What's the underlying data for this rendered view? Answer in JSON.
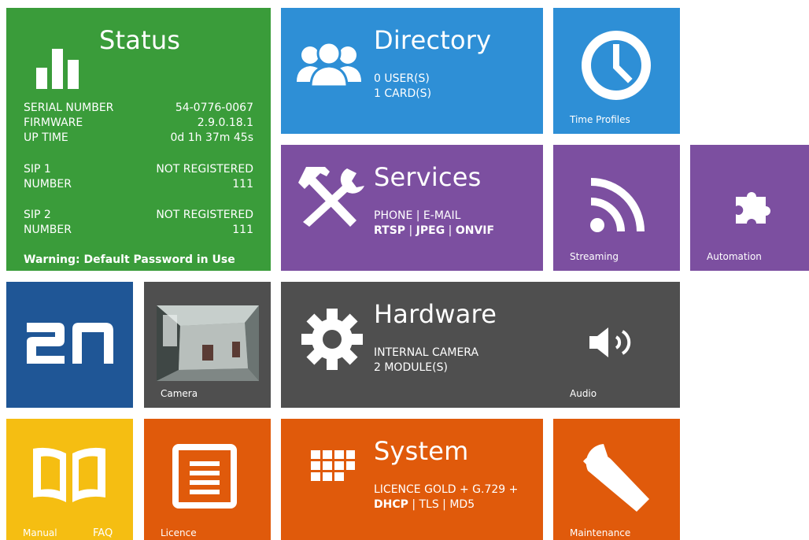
{
  "status": {
    "title": "Status",
    "rows": [
      {
        "label": "SERIAL NUMBER",
        "value": "54-0776-0067"
      },
      {
        "label": "FIRMWARE",
        "value": "2.9.0.18.1"
      },
      {
        "label": "UP TIME",
        "value": "0d 1h 37m 45s"
      }
    ],
    "sip1": [
      {
        "label": "SIP 1",
        "value": "NOT REGISTERED"
      },
      {
        "label": "NUMBER",
        "value": "111"
      }
    ],
    "sip2": [
      {
        "label": "SIP 2",
        "value": "NOT REGISTERED"
      },
      {
        "label": "NUMBER",
        "value": "111"
      }
    ],
    "warning": "Warning: Default Password in Use"
  },
  "directory": {
    "title": "Directory",
    "line1": "0 USER(S)",
    "line2": "1 CARD(S)"
  },
  "time_profiles": {
    "label": "Time Profiles"
  },
  "services": {
    "title": "Services",
    "line1": "PHONE | E-MAIL",
    "line2_a": "RTSP",
    "line2_sep1": " | ",
    "line2_b": "JPEG",
    "line2_sep2": " | ",
    "line2_c": "ONVIF"
  },
  "streaming": {
    "label": "Streaming"
  },
  "automation": {
    "label": "Automation"
  },
  "logo": {
    "text": "2N"
  },
  "camera": {
    "label": "Camera"
  },
  "hardware": {
    "title": "Hardware",
    "line1": "INTERNAL CAMERA",
    "line2": "2 MODULE(S)"
  },
  "audio": {
    "label": "Audio"
  },
  "manual": {
    "label": "Manual",
    "faq": "FAQ"
  },
  "licence": {
    "label": "Licence"
  },
  "system": {
    "title": "System",
    "line1": "LICENCE GOLD + G.729 +",
    "line2_a": "DHCP",
    "line2_b": " | TLS | MD5"
  },
  "maintenance": {
    "label": "Maintenance"
  },
  "colors": {
    "green": "#3a9c3a",
    "blue": "#2e8fd6",
    "purple": "#7c4fa0",
    "dark": "#4f4f4f",
    "navy": "#1f5696",
    "yellow": "#f5be12",
    "orange": "#e05a0b"
  }
}
